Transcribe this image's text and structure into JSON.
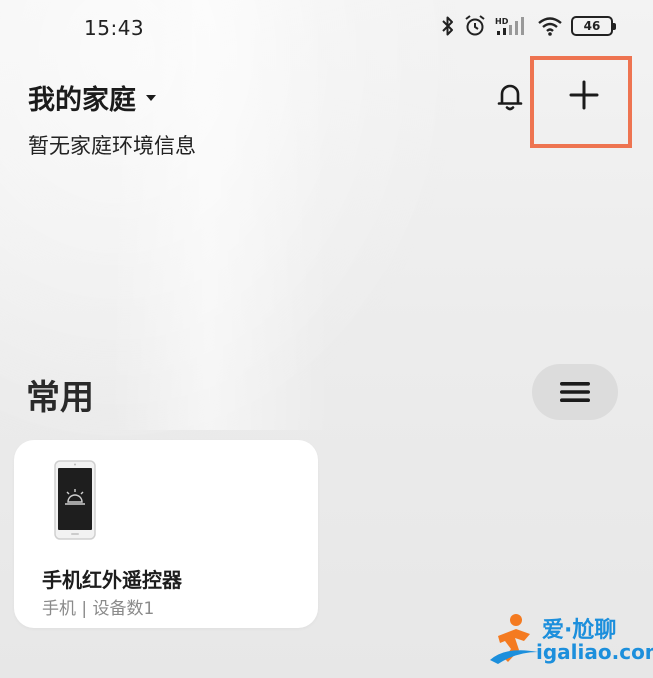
{
  "status_bar": {
    "time": "15:43",
    "battery_level": "46",
    "network_label": "HD",
    "icons": [
      "bluetooth-icon",
      "alarm-icon",
      "signal-icon",
      "wifi-icon",
      "battery-icon"
    ]
  },
  "header": {
    "home_name": "我的家庭",
    "subtitle": "暂无家庭环境信息",
    "icons": [
      "dropdown-caret-icon",
      "bell-icon",
      "plus-icon"
    ]
  },
  "colors": {
    "highlight": "#ee7451",
    "card_background": "#ffffff",
    "menu_button_background": "#dcdcdc",
    "watermark_blue": "#1c8fdc",
    "watermark_orange": "#f47a20"
  },
  "section": {
    "title": "常用",
    "menu_icon": "hamburger-menu-icon"
  },
  "devices": [
    {
      "name": "手机红外遥控器",
      "meta": "手机 | 设备数1",
      "icon": "phone-ir-remote-icon"
    }
  ],
  "watermark": {
    "brand": "爱·尬聊",
    "domain": "igaliao.com"
  }
}
